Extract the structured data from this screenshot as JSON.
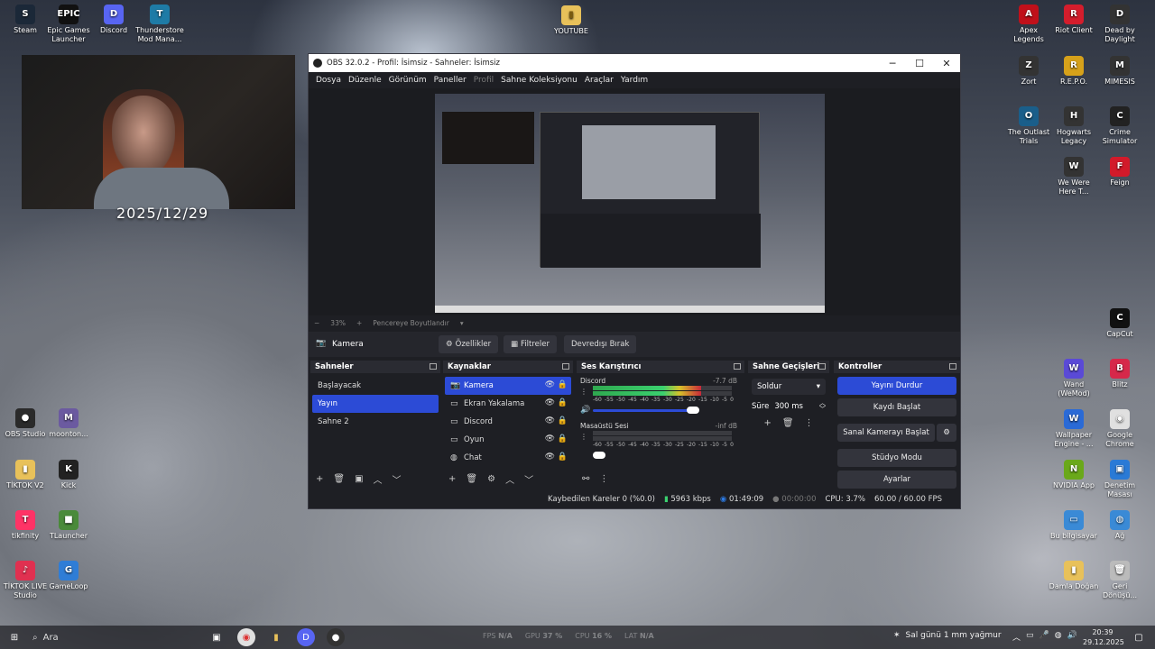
{
  "desktop_left": [
    {
      "label": "Steam",
      "color": "#1b2838",
      "glyph": "S"
    },
    {
      "label": "Epic Games Launcher",
      "color": "#111",
      "glyph": "EPIC"
    },
    {
      "label": "Discord",
      "color": "#5865f2",
      "glyph": "D"
    },
    {
      "label": "Thunderstore Mod Mana...",
      "color": "#1e7ba6",
      "glyph": "T"
    }
  ],
  "desktop_left_col": [
    {
      "label": "OBS Studio",
      "color": "#2a2a2a",
      "glyph": "●"
    },
    {
      "label": "moonton...",
      "color": "#6b5aa0",
      "glyph": "M"
    },
    {
      "label": "TİKTOK V2",
      "color": "#e8c15a",
      "glyph": "▮"
    },
    {
      "label": "Kick",
      "color": "#222",
      "glyph": "K"
    },
    {
      "label": "tikfinity",
      "color": "#ff3366",
      "glyph": "T"
    },
    {
      "label": "TLauncher",
      "color": "#4a8a3a",
      "glyph": "■"
    },
    {
      "label": "TİKTOK LIVE Studio",
      "color": "#e03050",
      "glyph": "♪"
    },
    {
      "label": "GameLoop",
      "color": "#2f7dd6",
      "glyph": "G"
    }
  ],
  "desktop_center": {
    "label": "YOUTUBE",
    "color": "#e8c15a",
    "glyph": "▮"
  },
  "desktop_right": [
    {
      "label": "Apex Legends",
      "color": "#c0101a",
      "glyph": "A"
    },
    {
      "label": "Riot Client",
      "color": "#d41d2c",
      "glyph": "R"
    },
    {
      "label": "Dead by Daylight",
      "color": "#333",
      "glyph": "D"
    },
    {
      "label": "Zort",
      "color": "#333",
      "glyph": "Z"
    },
    {
      "label": "R.E.P.O.",
      "color": "#d6a11a",
      "glyph": "R"
    },
    {
      "label": "MIMESIS",
      "color": "#333",
      "glyph": "M"
    },
    {
      "label": "The Outlast Trials",
      "color": "#1a5e8a",
      "glyph": "O"
    },
    {
      "label": "Hogwarts Legacy",
      "color": "#333",
      "glyph": "H"
    },
    {
      "label": "Crime Simulator",
      "color": "#222",
      "glyph": "C"
    },
    {
      "label": "We Were Here T...",
      "color": "#333",
      "glyph": "W"
    },
    {
      "label": "Feign",
      "color": "#d21a2a",
      "glyph": "F"
    },
    {
      "label": "CapCut",
      "color": "#111",
      "glyph": "C"
    },
    {
      "label": "Wand (WeMod)",
      "color": "#5a4ad6",
      "glyph": "W"
    },
    {
      "label": "Blitz",
      "color": "#d6284a",
      "glyph": "B"
    },
    {
      "label": "Wallpaper Engine - ...",
      "color": "#2a6ad6",
      "glyph": "W"
    },
    {
      "label": "Google Chrome",
      "color": "#e0e0e0",
      "glyph": "◉"
    },
    {
      "label": "NVIDIA App",
      "color": "#6aa81a",
      "glyph": "N"
    },
    {
      "label": "Denetim Masası",
      "color": "#2a7ad6",
      "glyph": "▣"
    },
    {
      "label": "Bu bilgisayar",
      "color": "#3a8ad6",
      "glyph": "▭"
    },
    {
      "label": "Ağ",
      "color": "#3a8ad6",
      "glyph": "◍"
    },
    {
      "label": "Damla Doğan",
      "color": "#e8c15a",
      "glyph": "▮"
    },
    {
      "label": "Geri Dönüşü...",
      "color": "#bbb",
      "glyph": "🗑"
    }
  ],
  "webcam_date": "2025/12/29",
  "obs": {
    "title": "OBS 32.0.2 - Profil: İsimsiz - Sahneler: İsimsiz",
    "menu": [
      "Dosya",
      "Düzenle",
      "Görünüm",
      "Paneller",
      "Profil",
      "Sahne Koleksiyonu",
      "Araçlar",
      "Yardım"
    ],
    "zoom": {
      "percent": "33%",
      "fit_label": "Pencereye Boyutlandır"
    },
    "context": {
      "source": "Kamera",
      "properties": "Özellikler",
      "filters": "Filtreler",
      "deactivate": "Devredışı Bırak"
    },
    "docks": {
      "scenes": {
        "title": "Sahneler",
        "items": [
          "Başlayacak",
          "Yayın",
          "Sahne 2"
        ],
        "selected": 1
      },
      "sources": {
        "title": "Kaynaklar",
        "items": [
          {
            "label": "Kamera",
            "icon": "📷"
          },
          {
            "label": "Ekran Yakalama",
            "icon": "▭"
          },
          {
            "label": "Discord",
            "icon": "▭"
          },
          {
            "label": "Oyun",
            "icon": "▭"
          },
          {
            "label": "Chat",
            "icon": "◍"
          }
        ]
      },
      "mixer": {
        "title": "Ses Karıştırıcı",
        "channels": [
          {
            "name": "Discord",
            "db": "-7.7 dB",
            "level": 0.78
          },
          {
            "name": "Masaüstü Sesi",
            "db": "-inf dB",
            "level": 0.0
          }
        ],
        "ticks": [
          "-60",
          "-55",
          "-50",
          "-45",
          "-40",
          "-35",
          "-30",
          "-25",
          "-20",
          "-15",
          "-10",
          "-5",
          "0"
        ]
      },
      "transitions": {
        "title": "Sahne Geçişleri",
        "type": "Soldur",
        "duration_label": "Süre",
        "duration": "300 ms"
      },
      "controls": {
        "title": "Kontroller",
        "buttons": [
          "Yayını Durdur",
          "Kaydı Başlat",
          "Sanal Kamerayı Başlat",
          "Stüdyo Modu",
          "Ayarlar"
        ]
      }
    },
    "status": {
      "dropped": "Kaybedilen Kareler 0 (%0.0)",
      "bitrate": "5963 kbps",
      "stream_time": "01:49:09",
      "rec_time": "00:00:00",
      "cpu": "CPU: 3.7%",
      "fps": "60.00 / 60.00 FPS"
    }
  },
  "taskbar": {
    "search_placeholder": "Ara",
    "perf": [
      {
        "k": "FPS",
        "v": "N/A"
      },
      {
        "k": "GPU",
        "v": "37 %"
      },
      {
        "k": "CPU",
        "v": "16 %"
      },
      {
        "k": "LAT",
        "v": "N/A"
      }
    ],
    "weather": "Sal günü 1 mm yağmur",
    "time": "20:39",
    "date": "29.12.2025"
  }
}
